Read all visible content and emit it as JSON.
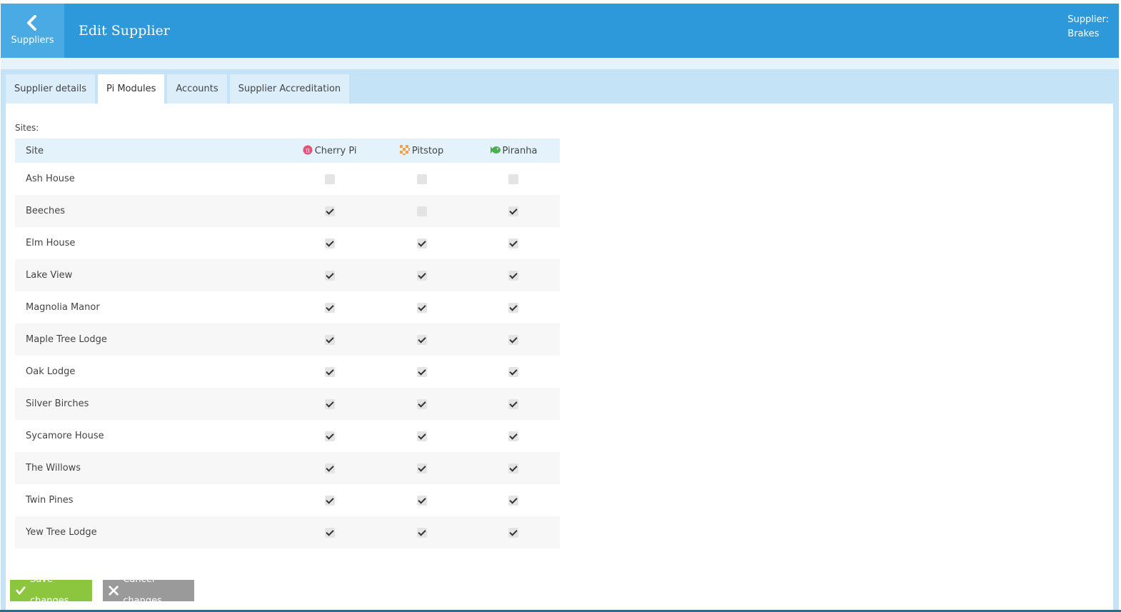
{
  "header": {
    "back_label": "Suppliers",
    "title": "Edit Supplier",
    "supplier_label": "Supplier:",
    "supplier_name": "Brakes"
  },
  "tabs": [
    {
      "label": "Supplier details",
      "active": false
    },
    {
      "label": "Pi Modules",
      "active": true
    },
    {
      "label": "Accounts",
      "active": false
    },
    {
      "label": "Supplier Accreditation",
      "active": false
    }
  ],
  "sites_label": "Sites:",
  "table": {
    "site_header": "Site",
    "modules": [
      {
        "label": "Cherry Pi",
        "icon": "cherry-pi-icon",
        "color": "#e5527a"
      },
      {
        "label": "Pitstop",
        "icon": "pitstop-icon",
        "color": "#f5a14a"
      },
      {
        "label": "Piranha",
        "icon": "piranha-icon",
        "color": "#4caf50"
      }
    ],
    "rows": [
      {
        "site": "Ash House",
        "cherry_pi": false,
        "pitstop": false,
        "piranha": false
      },
      {
        "site": "Beeches",
        "cherry_pi": true,
        "pitstop": false,
        "piranha": true
      },
      {
        "site": "Elm House",
        "cherry_pi": true,
        "pitstop": true,
        "piranha": true
      },
      {
        "site": "Lake View",
        "cherry_pi": true,
        "pitstop": true,
        "piranha": true
      },
      {
        "site": "Magnolia Manor",
        "cherry_pi": true,
        "pitstop": true,
        "piranha": true
      },
      {
        "site": "Maple Tree Lodge",
        "cherry_pi": true,
        "pitstop": true,
        "piranha": true
      },
      {
        "site": "Oak Lodge",
        "cherry_pi": true,
        "pitstop": true,
        "piranha": true
      },
      {
        "site": "Silver Birches",
        "cherry_pi": true,
        "pitstop": true,
        "piranha": true
      },
      {
        "site": "Sycamore House",
        "cherry_pi": true,
        "pitstop": true,
        "piranha": true
      },
      {
        "site": "The Willows",
        "cherry_pi": true,
        "pitstop": true,
        "piranha": true
      },
      {
        "site": "Twin Pines",
        "cherry_pi": true,
        "pitstop": true,
        "piranha": true
      },
      {
        "site": "Yew Tree Lodge",
        "cherry_pi": true,
        "pitstop": true,
        "piranha": true
      }
    ]
  },
  "buttons": {
    "save_label": "Save changes",
    "cancel_label": "Cancel changes"
  },
  "colors": {
    "header": "#2d99db",
    "save": "#8cc63f",
    "cancel": "#9a9a9a"
  }
}
